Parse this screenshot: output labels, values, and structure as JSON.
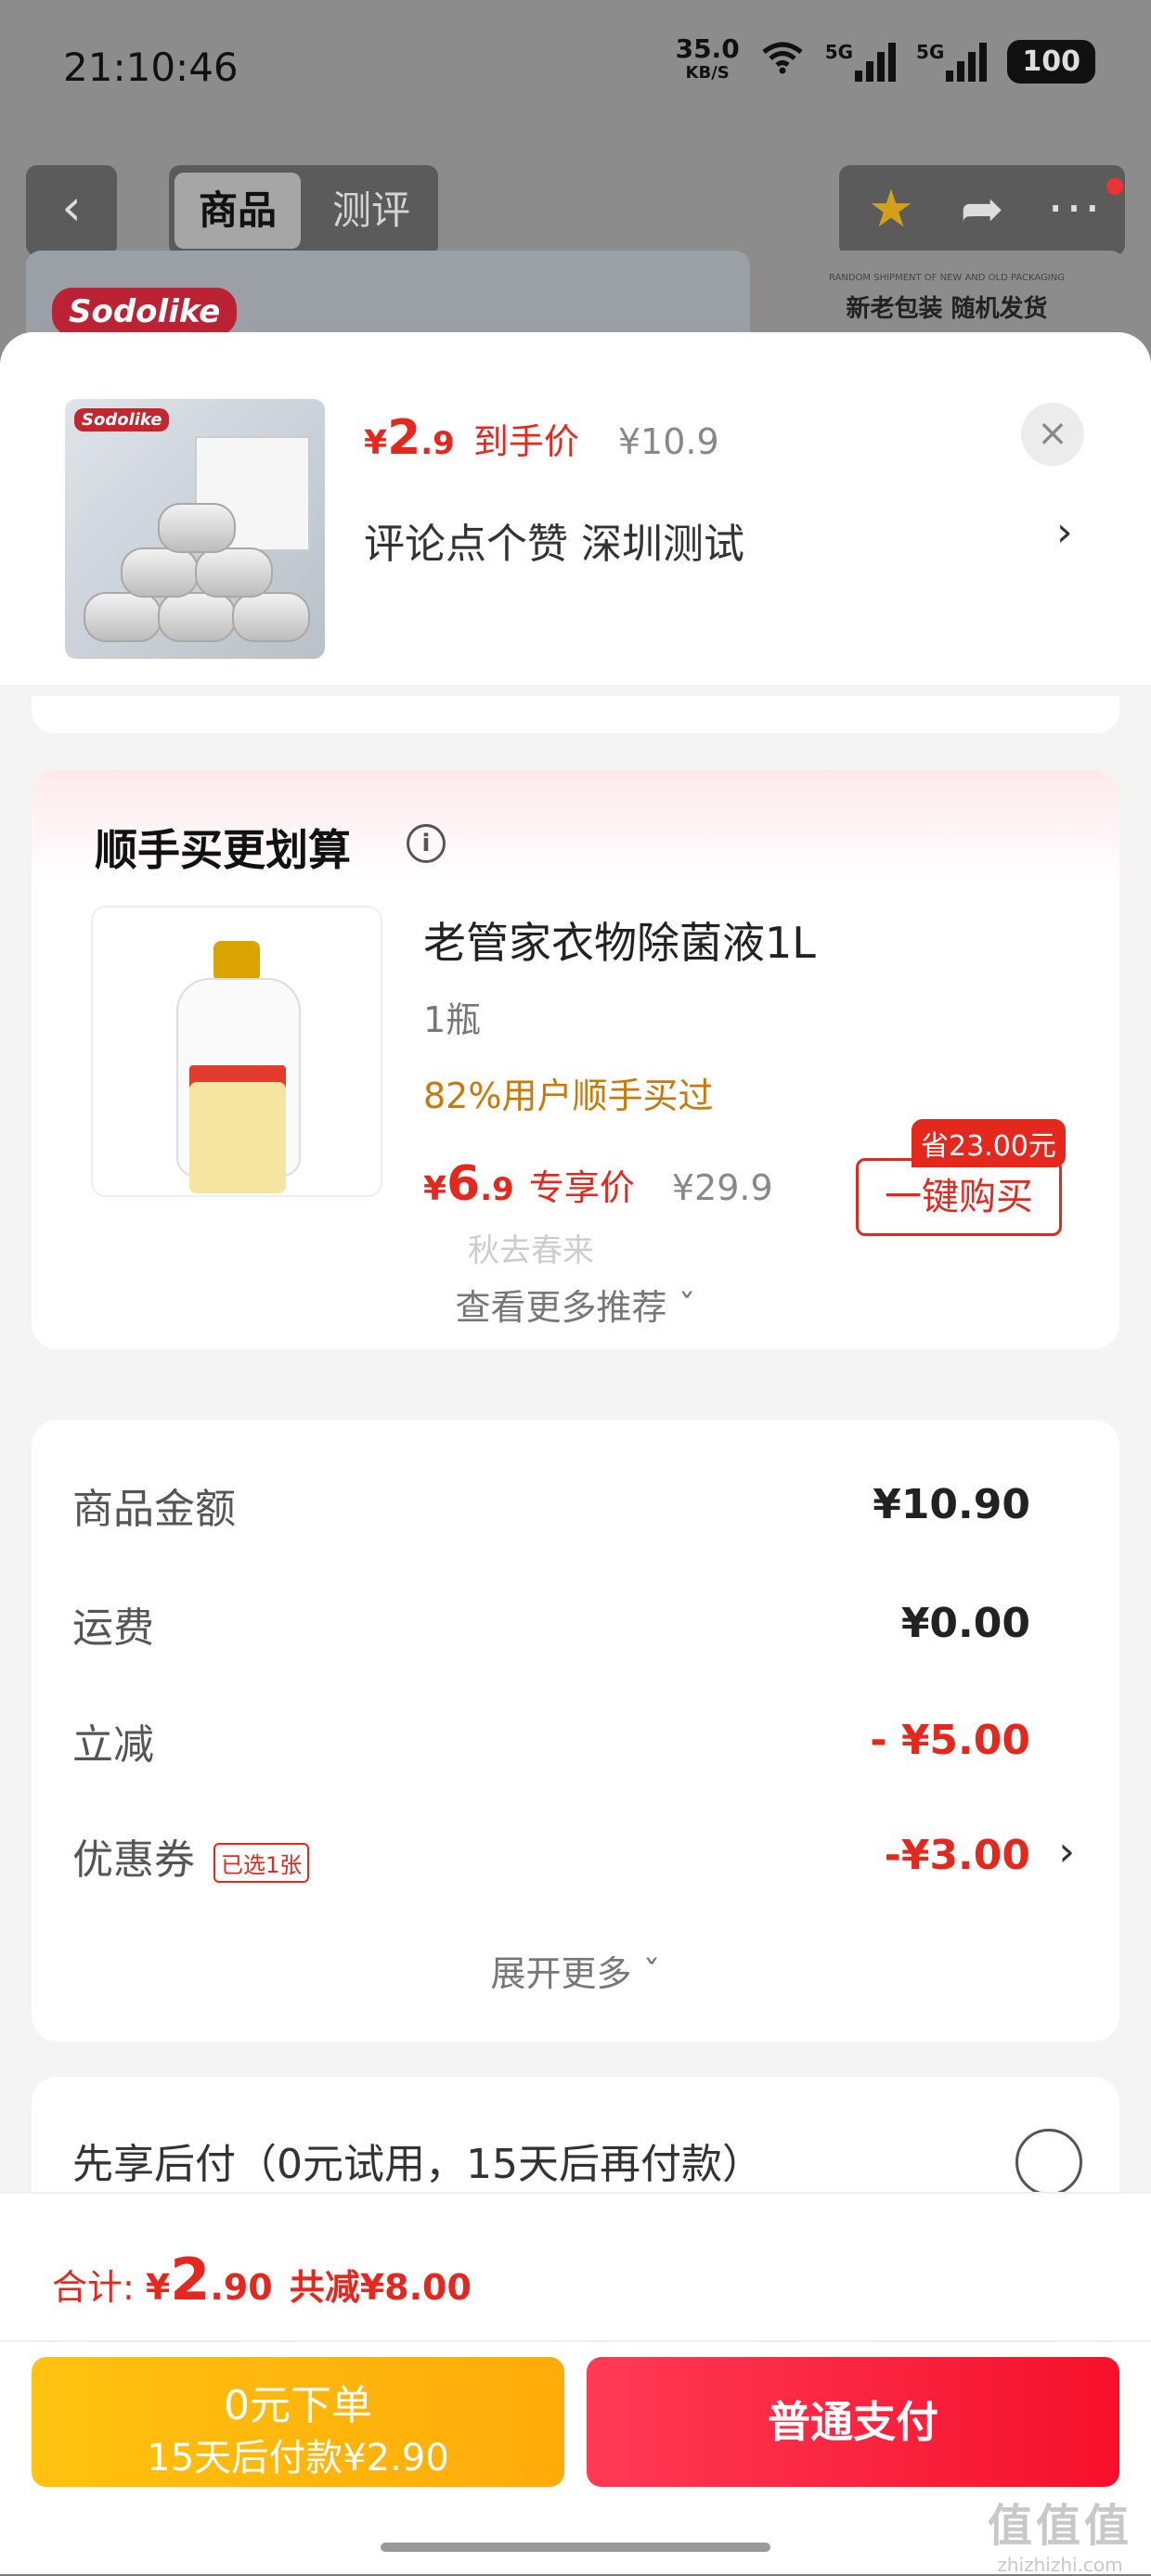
{
  "status_bar": {
    "time": "21:10:46",
    "speed_value": "35.0",
    "speed_unit": "KB/S",
    "signal1": "5G",
    "signal2": "5G",
    "battery": "100"
  },
  "nav": {
    "back_icon": "‹",
    "tab_product": "商品",
    "tab_review": "测评",
    "star_icon": "★",
    "share_icon": "➦",
    "more_icon": "···"
  },
  "background": {
    "brand": "Sodolike",
    "small_text": "RANDOM SHIPMENT OF NEW AND OLD PACKAGING",
    "note": "新老包装 随机发货"
  },
  "product_header": {
    "thumb_logo": "Sodolike",
    "yen": "¥",
    "price_int": "2",
    "price_dec": ".9",
    "price_tag": "到手价",
    "original_price": "¥10.9",
    "close_icon": "×",
    "sku_text": "评论点个赞  深圳测试",
    "sku_arrow": "›"
  },
  "upsell": {
    "title": "顺手买更划算",
    "info_icon": "i",
    "name": "老管家衣物除菌液1L",
    "spec": "1瓶",
    "rate": "82%用户顺手买过",
    "yen": "¥",
    "price_int": "6",
    "price_dec": ".9",
    "price_tag": "专享价",
    "original_price": "¥29.9",
    "save_tag": "省23.00元",
    "buy_label": "一键购买",
    "watermark": "秋去春来",
    "more_label": "查看更多推荐 ˇ"
  },
  "fees": {
    "rows": [
      {
        "label": "商品金额",
        "value": "¥10.90"
      },
      {
        "label": "运费",
        "value": "¥0.00"
      },
      {
        "label": "立减",
        "value": "- ¥5.00"
      },
      {
        "label": "优惠券",
        "chip": "已选1张",
        "value": "-¥3.00",
        "arrow": "›"
      }
    ],
    "expand_label": "展开更多 ˇ"
  },
  "pay_later": {
    "text": "先享后付（0元试用，15天后再付款）"
  },
  "footer": {
    "total_label": "合计:",
    "yen": "¥",
    "total_int": "2",
    "total_dec": ".90",
    "saved": "共减¥8.00",
    "zero_btn_line1": "0元下单",
    "zero_btn_line2": "15天后付款¥2.90",
    "pay_btn": "普通支付"
  },
  "watermark": {
    "logo": "值值值",
    "site": "zhizhizhi.com"
  },
  "colors": {
    "accent_red": "#e5281e",
    "orange": "#c8790a",
    "yellow_btn": "#ffb80c",
    "red_btn": "#f5102b"
  }
}
